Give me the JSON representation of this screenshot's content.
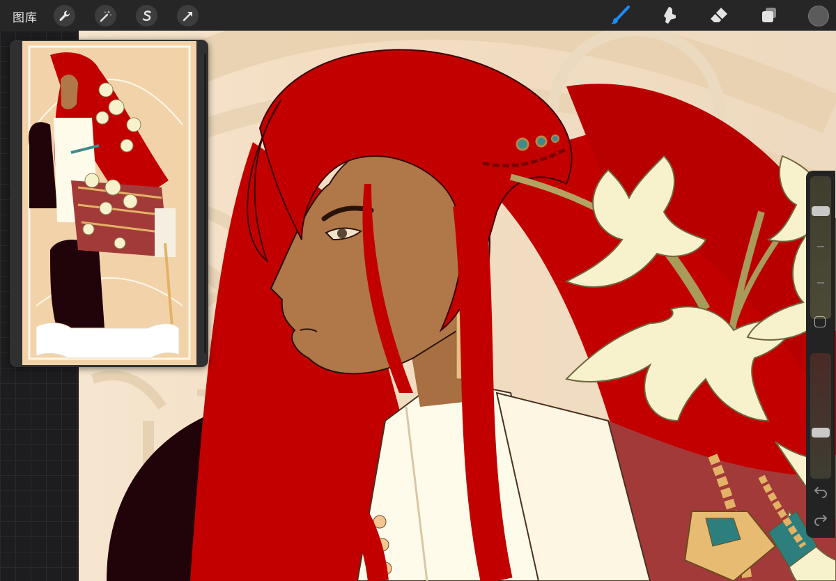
{
  "topbar": {
    "gallery_label": "图库",
    "left_tools": [
      "wrench-icon",
      "magic-wand-icon",
      "selection-s-icon",
      "move-arrow-icon"
    ],
    "right_tools": [
      "brush-icon",
      "smudge-icon",
      "eraser-icon",
      "layers-icon"
    ],
    "active_tool": "brush-icon",
    "current_color": "#5b5b5b",
    "accent_color": "#1a8cff"
  },
  "sidebar": {
    "brush_size_level": 0.78,
    "brush_opacity_level": 0.35,
    "undo_icon": "undo-icon",
    "redo_icon": "redo-icon"
  },
  "reference": {
    "label_banner_text": ""
  },
  "colors": {
    "hair": "#c20000",
    "skin": "#b07848",
    "coat": "#fffbeb",
    "fur": "#210409",
    "lily": "#f8f2cc",
    "background_ornament": "#e9d6bd"
  }
}
